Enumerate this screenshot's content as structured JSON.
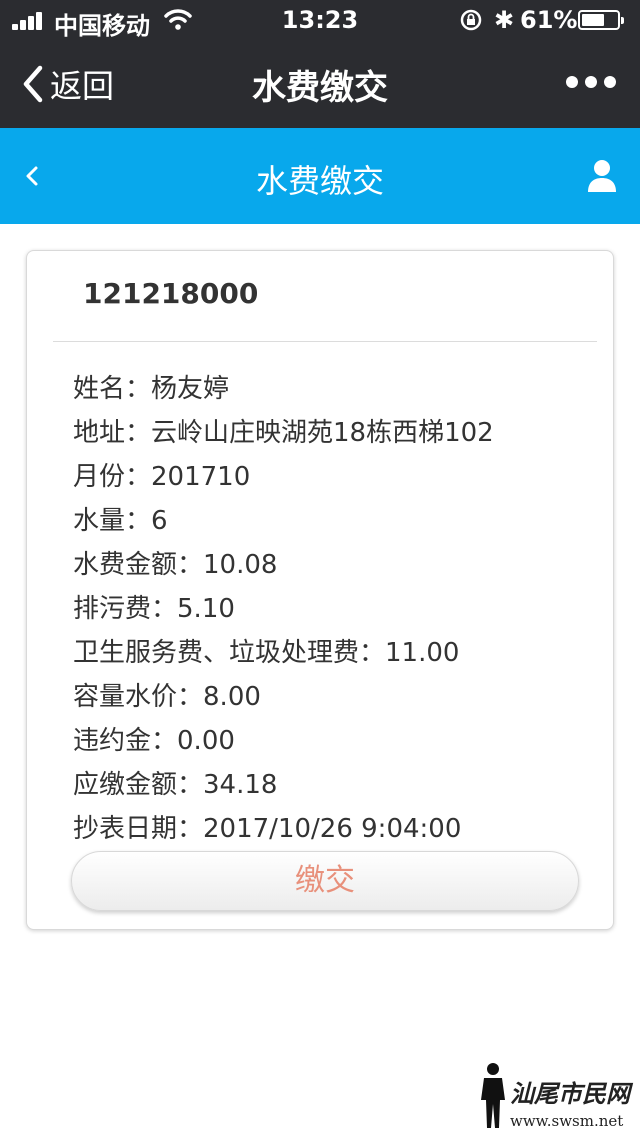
{
  "status_bar": {
    "carrier": "中国移动",
    "time": "13:23",
    "battery_percent": "61%",
    "battery_level": 0.61
  },
  "wechat_bar": {
    "back_label": "返回",
    "title": "水费缴交"
  },
  "header": {
    "title": "水费缴交"
  },
  "card": {
    "account_number": "121218000",
    "rows": [
      {
        "label": "姓名：",
        "value": "杨友婷"
      },
      {
        "label": "地址：",
        "value": "云岭山庄映湖苑18栋西梯102"
      },
      {
        "label": "月份：",
        "value": "201710"
      },
      {
        "label": "水量：",
        "value": "6"
      },
      {
        "label": "水费金额：",
        "value": "10.08"
      },
      {
        "label": "排污费：",
        "value": "5.10"
      },
      {
        "label": "卫生服务费、垃圾处理费：",
        "value": "11.00"
      },
      {
        "label": "容量水价：",
        "value": "8.00"
      },
      {
        "label": "违约金：",
        "value": "0.00"
      },
      {
        "label": "应缴金额：",
        "value": "34.18"
      },
      {
        "label": "抄表日期：",
        "value": "2017/10/26 9:04:00"
      }
    ],
    "pay_button": "缴交"
  },
  "watermark": {
    "text": "汕尾市民网",
    "url": "www.swsm.net"
  },
  "colors": {
    "wechat_bar": "#2b2c30",
    "header_blue": "#08a8ec",
    "pay_text": "#e8907b"
  }
}
